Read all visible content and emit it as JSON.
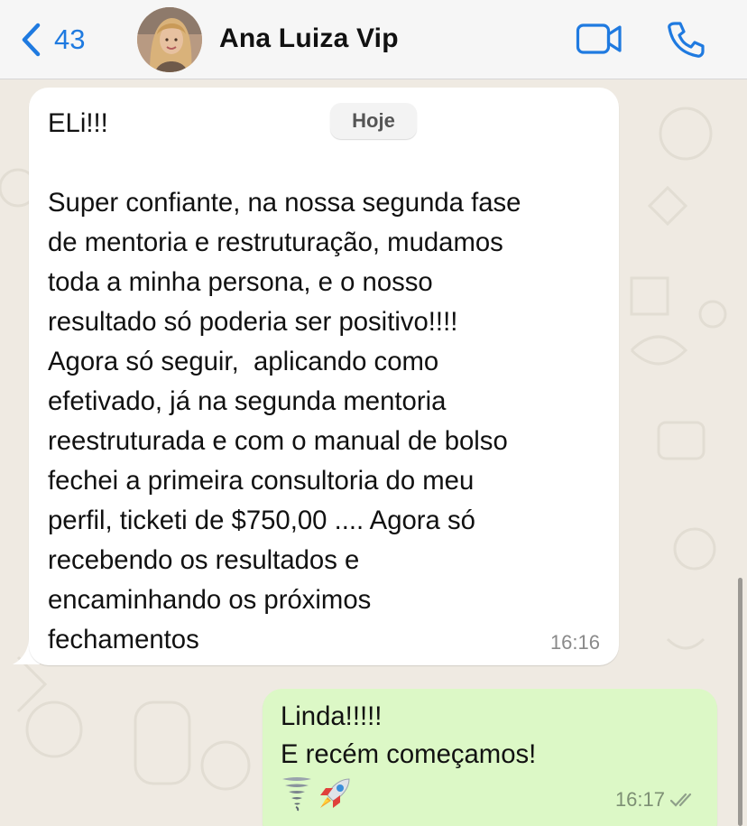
{
  "header": {
    "back_count": "43",
    "contact_name": "Ana Luiza Vip",
    "icons": {
      "back": "chevron-left-icon",
      "video": "video-camera-icon",
      "call": "phone-icon"
    },
    "accent_color": "#1f7ae0"
  },
  "chat": {
    "date_chip": "Hoje",
    "messages": [
      {
        "direction": "incoming",
        "text": "ELi!!!\n\nSuper confiante, na nossa segunda fase\nde mentoria e restruturação, mudamos\ntoda a minha persona, e o nosso\nresultado só poderia ser positivo!!!!\nAgora só seguir,  aplicando como\nefetivado, já na segunda mentoria\nreestruturada e com o manual de bolso\nfechei a primeira consultoria do meu\nperfil, ticketi de $750,00 .... Agora só\nrecebendo os resultados e\nencaminhando os próximos\nfechamentos",
        "time": "16:16",
        "bubble_color": "#ffffff"
      },
      {
        "direction": "outgoing",
        "text": "Linda!!!!!\nE recém começamos!",
        "emojis": [
          "tornado-icon",
          "rocket-icon"
        ],
        "time": "16:17",
        "status": "read-double-check-icon",
        "bubble_color": "#dcf8c6"
      }
    ]
  }
}
